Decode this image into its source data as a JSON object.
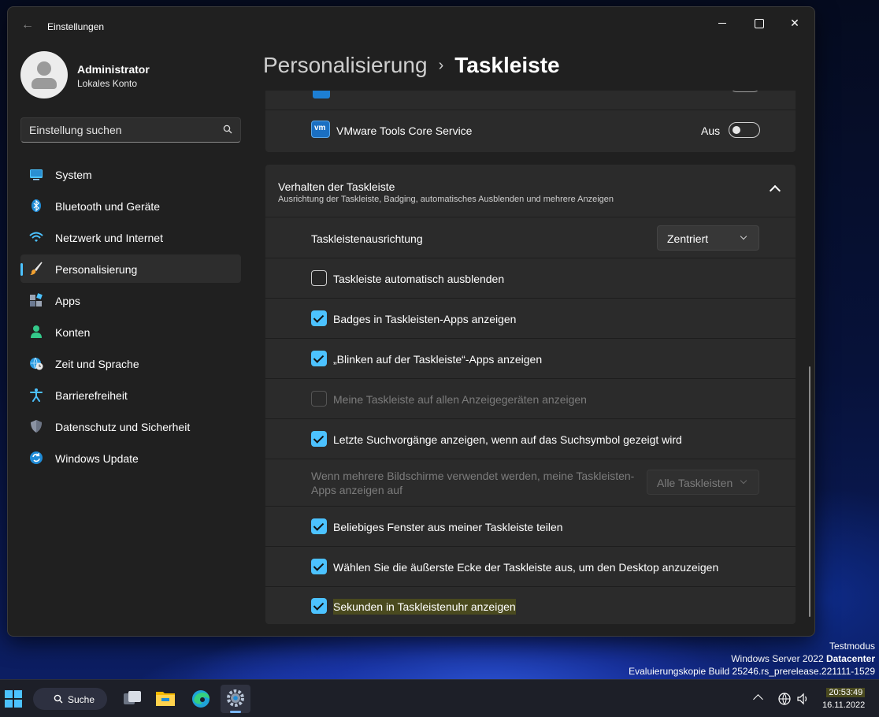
{
  "window": {
    "title": "Einstellungen",
    "back_glyph": "←",
    "close_glyph": "✕"
  },
  "profile": {
    "name": "Administrator",
    "account_type": "Lokales Konto"
  },
  "search": {
    "placeholder": "Einstellung suchen"
  },
  "sidebar": {
    "items": [
      {
        "label": "System",
        "icon": "monitor-icon"
      },
      {
        "label": "Bluetooth und Geräte",
        "icon": "bluetooth-icon"
      },
      {
        "label": "Netzwerk und Internet",
        "icon": "wifi-icon"
      },
      {
        "label": "Personalisierung",
        "icon": "paintbrush-icon",
        "active": true
      },
      {
        "label": "Apps",
        "icon": "apps-icon"
      },
      {
        "label": "Konten",
        "icon": "person-icon"
      },
      {
        "label": "Zeit und Sprache",
        "icon": "globe-clock-icon"
      },
      {
        "label": "Barrierefreiheit",
        "icon": "accessibility-icon"
      },
      {
        "label": "Datenschutz und Sicherheit",
        "icon": "shield-icon"
      },
      {
        "label": "Windows Update",
        "icon": "update-icon"
      }
    ]
  },
  "breadcrumb": {
    "parent": "Personalisierung",
    "separator": "›",
    "current": "Taskleiste"
  },
  "tray_services": {
    "vmware_label": "VMware Tools Core Service",
    "vmware_state": "Aus"
  },
  "behavior": {
    "title": "Verhalten der Taskleiste",
    "subtitle": "Ausrichtung der Taskleiste, Badging, automatisches Ausblenden und mehrere Anzeigen",
    "alignment_label": "Taskleistenausrichtung",
    "alignment_value": "Zentriert",
    "options": [
      {
        "label": "Taskleiste automatisch ausblenden",
        "checked": false
      },
      {
        "label": "Badges in Taskleisten-Apps anzeigen",
        "checked": true
      },
      {
        "label": "„Blinken auf der Taskleiste“-Apps anzeigen",
        "checked": true
      },
      {
        "label": "Meine Taskleiste auf allen Anzeigegeräten anzeigen",
        "checked": false,
        "disabled": true
      },
      {
        "label": "Letzte Suchvorgänge anzeigen, wenn auf das Suchsymbol gezeigt wird",
        "checked": true
      }
    ],
    "multi_display_label_line1": "Wenn mehrere Bildschirme verwendet werden, meine Taskleisten-",
    "multi_display_label_line2": "Apps anzeigen auf",
    "multi_display_value": "Alle Taskleisten",
    "options2": [
      {
        "label": "Beliebiges Fenster aus meiner Taskleiste teilen",
        "checked": true
      },
      {
        "label": "Wählen Sie die äußerste Ecke der Taskleiste aus, um den Desktop anzuzeigen",
        "checked": true
      },
      {
        "label": "Sekunden in Taskleistenuhr anzeigen",
        "checked": true
      }
    ]
  },
  "watermark": {
    "line1": "Testmodus",
    "line2_prefix": "Windows Server 2022 ",
    "line2_bold": "Datacenter",
    "line3": "Evaluierungskopie Build 25246.rs_prerelease.221111-1529"
  },
  "taskbar": {
    "search_label": "Suche",
    "time": "20:53:49",
    "date": "16.11.2022"
  },
  "colors": {
    "accent": "#4cc2ff",
    "window_bg": "#202020",
    "card_bg": "#2b2b2b"
  }
}
